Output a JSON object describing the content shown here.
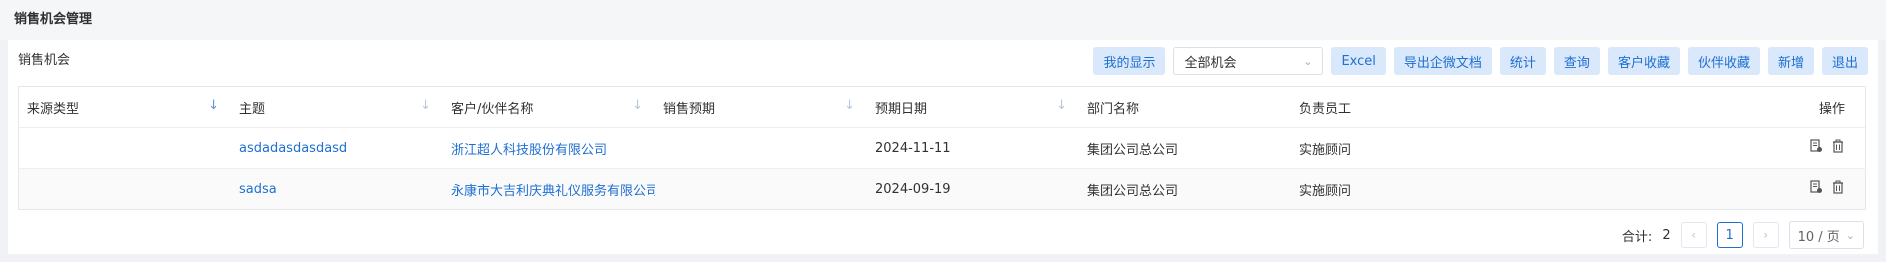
{
  "page": {
    "title": "销售机会管理"
  },
  "toolbar": {
    "section_label": "销售机会",
    "my_display": "我的显示",
    "filter_value": "全部机会",
    "buttons": [
      "Excel",
      "导出企微文档",
      "统计",
      "查询",
      "客户收藏",
      "伙伴收藏",
      "新增",
      "退出"
    ]
  },
  "table": {
    "headers": [
      "来源类型",
      "主题",
      "客户/伙伴名称",
      "销售预期",
      "预期日期",
      "部门名称",
      "负责员工",
      "操作"
    ],
    "rows": [
      {
        "source": "",
        "subject": "asdadasdasdasd",
        "customer": "浙江超人科技股份有限公司",
        "expectation": "",
        "date": "2024-11-11",
        "dept": "集团公司总公司",
        "owner": "实施顾问"
      },
      {
        "source": "",
        "subject": "sadsa",
        "customer": "永康市大吉利庆典礼仪服务有限公司",
        "expectation": "",
        "date": "2024-09-19",
        "dept": "集团公司总公司",
        "owner": "实施顾问"
      }
    ]
  },
  "pagination": {
    "total_label": "合计:",
    "total": "2",
    "current_page": "1",
    "page_size": "10 / 页"
  },
  "colors": {
    "accent": "#1f6fd1",
    "button_bg": "#d9e8fb"
  },
  "icons": {
    "sort": "sort-down-icon",
    "edit": "document-edit-icon",
    "delete": "trash-icon"
  }
}
